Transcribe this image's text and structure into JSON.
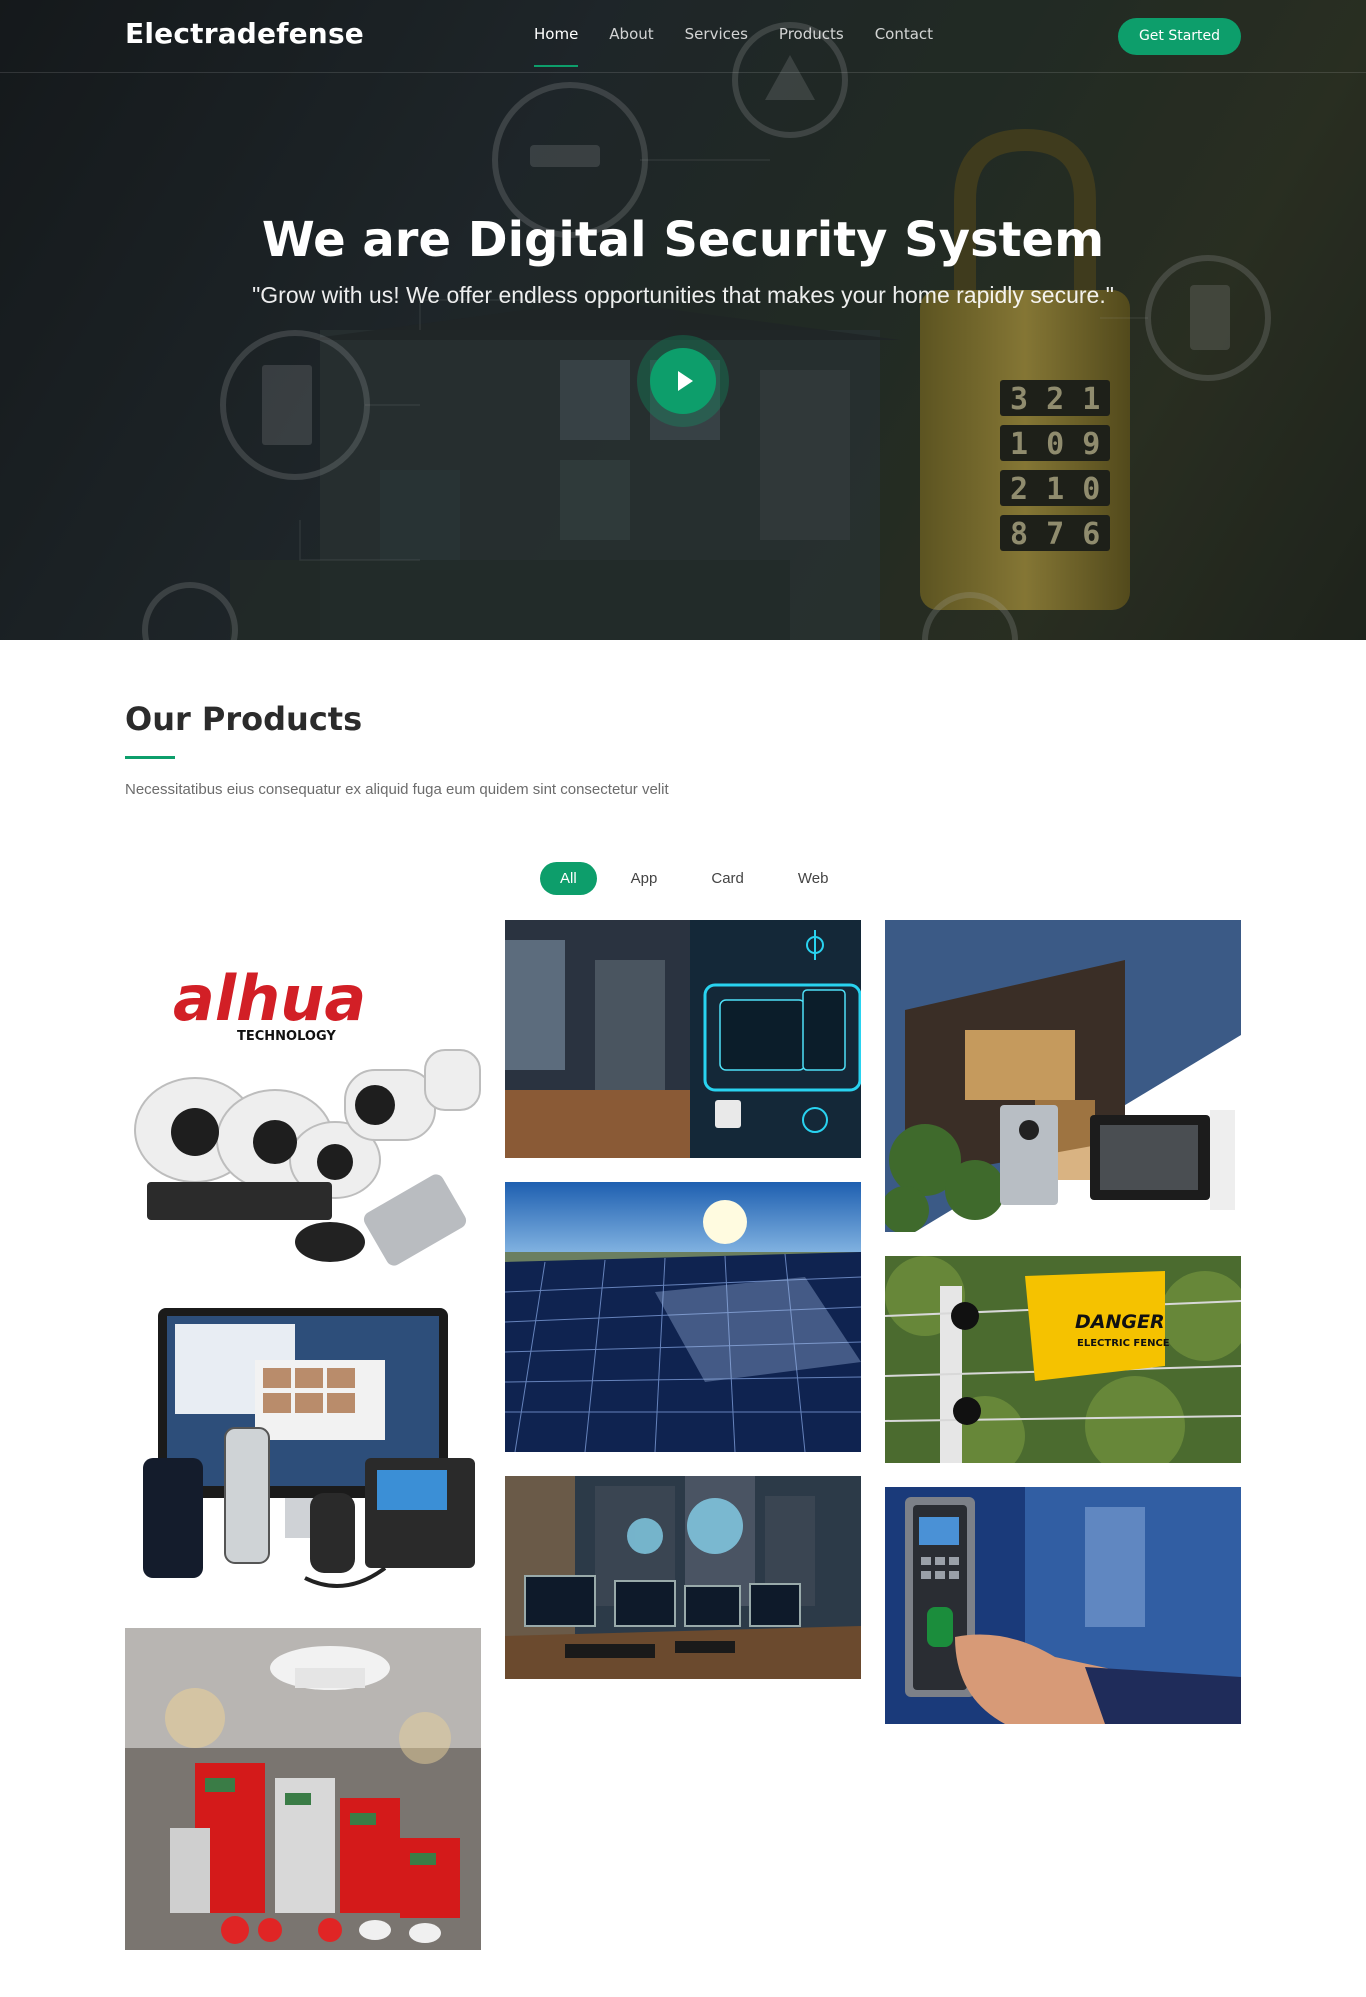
{
  "brand": "Electradefense",
  "nav": {
    "items": [
      "Home",
      "About",
      "Services",
      "Products",
      "Contact"
    ],
    "active": "Home",
    "cta_label": "Get Started"
  },
  "hero": {
    "title": "We are Digital Security System",
    "subtitle": "\"Grow with us! We offer endless opportunities that makes your home rapidly secure.\"",
    "lock_digits": [
      "3 2 1",
      "1 0 9",
      "2 1 0",
      "8 7 6"
    ]
  },
  "products": {
    "title": "Our Products",
    "description": "Necessitatibus eius consequatur ex aliquid fuga eum quidem sint consectetur velit",
    "filters": [
      "All",
      "App",
      "Card",
      "Web"
    ],
    "active_filter": "All",
    "items": [
      {
        "name": "dahua-cctv-kit",
        "brand_text": "alhua",
        "brand_sub": "TECHNOLOGY"
      },
      {
        "name": "smart-home-panel"
      },
      {
        "name": "video-door-phone"
      },
      {
        "name": "ip-telephony"
      },
      {
        "name": "solar-panels"
      },
      {
        "name": "electric-fence",
        "sign_text": "DANGER",
        "sign_sub": "ELECTRIC FENCE"
      },
      {
        "name": "fire-alarm-system"
      },
      {
        "name": "network-servers"
      },
      {
        "name": "biometric-access"
      }
    ]
  },
  "colors": {
    "accent": "#0d9e6b",
    "dahua_red": "#d21f26"
  }
}
